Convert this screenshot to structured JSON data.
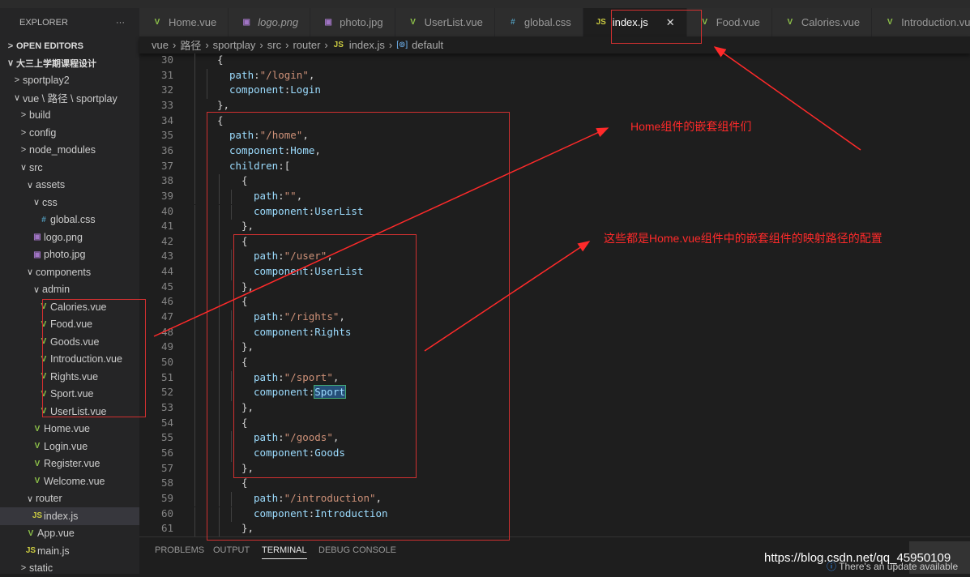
{
  "explorer": {
    "title": "EXPLORER",
    "more": "···",
    "open_editors": "OPEN EDITORS",
    "tree": [
      {
        "label": "大三上学期课程设计",
        "depth": 0,
        "chev": "v",
        "bold": true
      },
      {
        "label": "sportplay2",
        "depth": 1,
        "chev": ">"
      },
      {
        "label": "vue \\ 路径 \\ sportplay",
        "depth": 1,
        "chev": "v"
      },
      {
        "label": "build",
        "depth": 2,
        "chev": ">"
      },
      {
        "label": "config",
        "depth": 2,
        "chev": ">"
      },
      {
        "label": "node_modules",
        "depth": 2,
        "chev": ">"
      },
      {
        "label": "src",
        "depth": 2,
        "chev": "v"
      },
      {
        "label": "assets",
        "depth": 3,
        "chev": "v"
      },
      {
        "label": "css",
        "depth": 4,
        "chev": "v"
      },
      {
        "label": "global.css",
        "depth": 5,
        "icon": "css"
      },
      {
        "label": "logo.png",
        "depth": 4,
        "icon": "img"
      },
      {
        "label": "photo.jpg",
        "depth": 4,
        "icon": "img"
      },
      {
        "label": "components",
        "depth": 3,
        "chev": "v"
      },
      {
        "label": "admin",
        "depth": 4,
        "chev": "v"
      },
      {
        "label": "Calories.vue",
        "depth": 5,
        "icon": "vue"
      },
      {
        "label": "Food.vue",
        "depth": 5,
        "icon": "vue"
      },
      {
        "label": "Goods.vue",
        "depth": 5,
        "icon": "vue"
      },
      {
        "label": "Introduction.vue",
        "depth": 5,
        "icon": "vue"
      },
      {
        "label": "Rights.vue",
        "depth": 5,
        "icon": "vue"
      },
      {
        "label": "Sport.vue",
        "depth": 5,
        "icon": "vue"
      },
      {
        "label": "UserList.vue",
        "depth": 5,
        "icon": "vue"
      },
      {
        "label": "Home.vue",
        "depth": 4,
        "icon": "vue"
      },
      {
        "label": "Login.vue",
        "depth": 4,
        "icon": "vue"
      },
      {
        "label": "Register.vue",
        "depth": 4,
        "icon": "vue"
      },
      {
        "label": "Welcome.vue",
        "depth": 4,
        "icon": "vue"
      },
      {
        "label": "router",
        "depth": 3,
        "chev": "v"
      },
      {
        "label": "index.js",
        "depth": 4,
        "icon": "js",
        "selected": true
      },
      {
        "label": "App.vue",
        "depth": 3,
        "icon": "vue"
      },
      {
        "label": "main.js",
        "depth": 3,
        "icon": "js"
      },
      {
        "label": "static",
        "depth": 2,
        "chev": ">"
      }
    ]
  },
  "tabs": [
    {
      "label": "Home.vue",
      "icon": "vue"
    },
    {
      "label": "logo.png",
      "icon": "img",
      "italic": true
    },
    {
      "label": "photo.jpg",
      "icon": "img"
    },
    {
      "label": "UserList.vue",
      "icon": "vue"
    },
    {
      "label": "global.css",
      "icon": "css"
    },
    {
      "label": "index.js",
      "icon": "js",
      "active": true
    },
    {
      "label": "Food.vue",
      "icon": "vue"
    },
    {
      "label": "Calories.vue",
      "icon": "vue"
    },
    {
      "label": "Introduction.vue",
      "icon": "vue"
    }
  ],
  "breadcrumb": [
    "vue",
    "路径",
    "sportplay",
    "src",
    "router",
    "index.js",
    "default"
  ],
  "code": [
    {
      "n": "30",
      "i": 1,
      "t": [
        [
          "{",
          "p"
        ]
      ]
    },
    {
      "n": "31",
      "i": 2,
      "t": [
        [
          "path",
          "k"
        ],
        [
          ":",
          "p"
        ],
        [
          "\"/login\"",
          "s"
        ],
        [
          ",",
          "p"
        ]
      ]
    },
    {
      "n": "32",
      "i": 2,
      "t": [
        [
          "component",
          "k"
        ],
        [
          ":",
          "p"
        ],
        [
          "Login",
          "k"
        ]
      ]
    },
    {
      "n": "33",
      "i": 1,
      "t": [
        [
          "},",
          "p"
        ]
      ]
    },
    {
      "n": "34",
      "i": 1,
      "t": [
        [
          "{",
          "p"
        ]
      ]
    },
    {
      "n": "35",
      "i": 2,
      "t": [
        [
          "path",
          "k"
        ],
        [
          ":",
          "p"
        ],
        [
          "\"/home\"",
          "s"
        ],
        [
          ",",
          "p"
        ]
      ]
    },
    {
      "n": "36",
      "i": 2,
      "t": [
        [
          "component",
          "k"
        ],
        [
          ":",
          "p"
        ],
        [
          "Home",
          "k"
        ],
        [
          ",",
          "p"
        ]
      ]
    },
    {
      "n": "37",
      "i": 2,
      "t": [
        [
          "children",
          "k"
        ],
        [
          ":[",
          "p"
        ]
      ]
    },
    {
      "n": "38",
      "i": 3,
      "t": [
        [
          "{",
          "p"
        ]
      ]
    },
    {
      "n": "39",
      "i": 4,
      "t": [
        [
          "path",
          "k"
        ],
        [
          ":",
          "p"
        ],
        [
          "\"\"",
          "s"
        ],
        [
          ",",
          "p"
        ]
      ]
    },
    {
      "n": "40",
      "i": 4,
      "t": [
        [
          "component",
          "k"
        ],
        [
          ":",
          "p"
        ],
        [
          "UserList",
          "k"
        ]
      ]
    },
    {
      "n": "41",
      "i": 3,
      "t": [
        [
          "},",
          "p"
        ]
      ]
    },
    {
      "n": "42",
      "i": 3,
      "t": [
        [
          "{",
          "p"
        ]
      ]
    },
    {
      "n": "43",
      "i": 4,
      "t": [
        [
          "path",
          "k"
        ],
        [
          ":",
          "p"
        ],
        [
          "\"/user\"",
          "s"
        ],
        [
          ",",
          "p"
        ]
      ]
    },
    {
      "n": "44",
      "i": 4,
      "t": [
        [
          "component",
          "k"
        ],
        [
          ":",
          "p"
        ],
        [
          "UserList",
          "k"
        ]
      ]
    },
    {
      "n": "45",
      "i": 3,
      "t": [
        [
          "},",
          "p"
        ]
      ]
    },
    {
      "n": "46",
      "i": 3,
      "t": [
        [
          "{",
          "p"
        ]
      ]
    },
    {
      "n": "47",
      "i": 4,
      "t": [
        [
          "path",
          "k"
        ],
        [
          ":",
          "p"
        ],
        [
          "\"/rights\"",
          "s"
        ],
        [
          ",",
          "p"
        ]
      ]
    },
    {
      "n": "48",
      "i": 4,
      "t": [
        [
          "component",
          "k"
        ],
        [
          ":",
          "p"
        ],
        [
          "Rights",
          "k"
        ]
      ]
    },
    {
      "n": "49",
      "i": 3,
      "t": [
        [
          "},",
          "p"
        ]
      ]
    },
    {
      "n": "50",
      "i": 3,
      "t": [
        [
          "{",
          "p"
        ]
      ]
    },
    {
      "n": "51",
      "i": 4,
      "t": [
        [
          "path",
          "k"
        ],
        [
          ":",
          "p"
        ],
        [
          "\"/sport\"",
          "s"
        ],
        [
          ",",
          "p"
        ]
      ]
    },
    {
      "n": "52",
      "i": 4,
      "t": [
        [
          "component",
          "k"
        ],
        [
          ":",
          "p"
        ],
        [
          "Sport",
          "k"
        ]
      ]
    },
    {
      "n": "53",
      "i": 3,
      "t": [
        [
          "},",
          "p"
        ]
      ]
    },
    {
      "n": "54",
      "i": 3,
      "t": [
        [
          "{",
          "p"
        ]
      ]
    },
    {
      "n": "55",
      "i": 4,
      "t": [
        [
          "path",
          "k"
        ],
        [
          ":",
          "p"
        ],
        [
          "\"/goods\"",
          "s"
        ],
        [
          ",",
          "p"
        ]
      ]
    },
    {
      "n": "56",
      "i": 4,
      "t": [
        [
          "component",
          "k"
        ],
        [
          ":",
          "p"
        ],
        [
          "Goods",
          "k"
        ]
      ]
    },
    {
      "n": "57",
      "i": 3,
      "t": [
        [
          "},",
          "p"
        ]
      ]
    },
    {
      "n": "58",
      "i": 3,
      "t": [
        [
          "{",
          "p"
        ]
      ]
    },
    {
      "n": "59",
      "i": 4,
      "t": [
        [
          "path",
          "k"
        ],
        [
          ":",
          "p"
        ],
        [
          "\"/introduction\"",
          "s"
        ],
        [
          ",",
          "p"
        ]
      ]
    },
    {
      "n": "60",
      "i": 4,
      "t": [
        [
          "component",
          "k"
        ],
        [
          ":",
          "p"
        ],
        [
          "Introduction",
          "k"
        ]
      ]
    },
    {
      "n": "61",
      "i": 3,
      "t": [
        [
          "},",
          "p"
        ]
      ]
    }
  ],
  "panel": {
    "tabs": [
      "PROBLEMS",
      "OUTPUT",
      "TERMINAL",
      "DEBUG CONSOLE"
    ],
    "active": "TERMINAL"
  },
  "annotations": {
    "note1": "Home组件的嵌套组件们",
    "note2": "这些都是Home.vue组件中的嵌套组件的映射路径的配置",
    "color": "#ff2a2a"
  },
  "watermark": "https://blog.csdn.net/qq_45950109",
  "notification": "There's an update available"
}
